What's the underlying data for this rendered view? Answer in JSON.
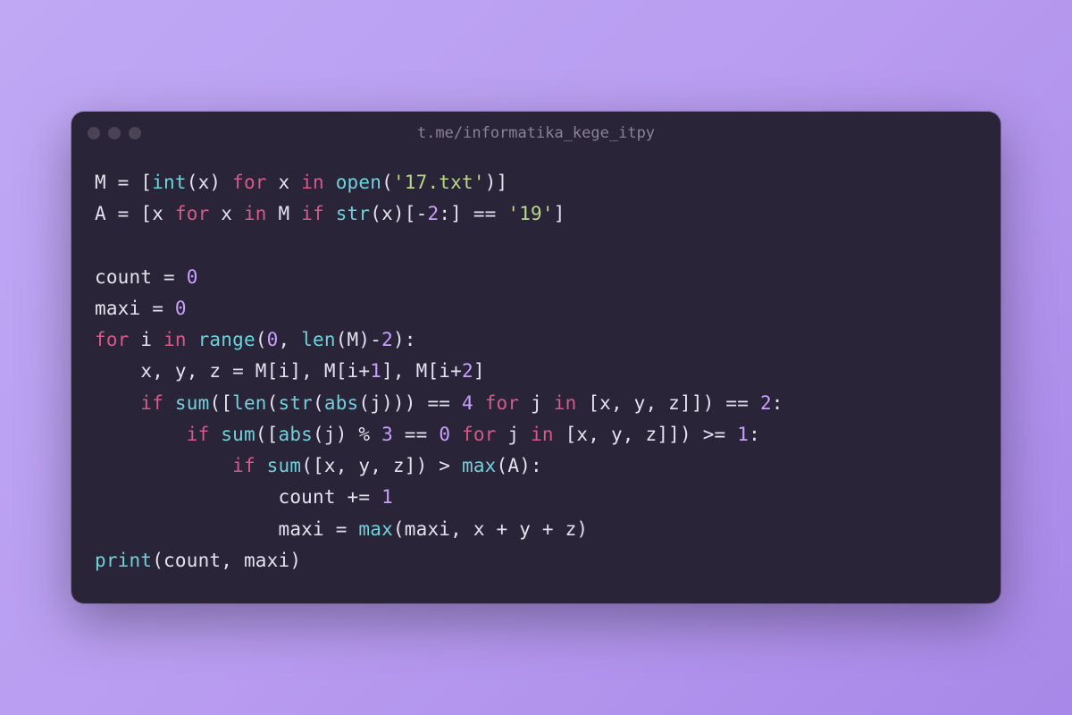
{
  "window": {
    "title": "t.me/informatika_kege_itpy"
  },
  "code": {
    "lines": [
      [
        {
          "t": "M",
          "c": "var"
        },
        {
          "t": " = [",
          "c": "punc"
        },
        {
          "t": "int",
          "c": "fn"
        },
        {
          "t": "(x) ",
          "c": "punc"
        },
        {
          "t": "for",
          "c": "kw"
        },
        {
          "t": " x ",
          "c": "var"
        },
        {
          "t": "in",
          "c": "kw"
        },
        {
          "t": " ",
          "c": "punc"
        },
        {
          "t": "open",
          "c": "fn"
        },
        {
          "t": "(",
          "c": "punc"
        },
        {
          "t": "'17.txt'",
          "c": "str"
        },
        {
          "t": ")]",
          "c": "punc"
        }
      ],
      [
        {
          "t": "A",
          "c": "var"
        },
        {
          "t": " = [x ",
          "c": "punc"
        },
        {
          "t": "for",
          "c": "kw"
        },
        {
          "t": " x ",
          "c": "var"
        },
        {
          "t": "in",
          "c": "kw"
        },
        {
          "t": " M ",
          "c": "var"
        },
        {
          "t": "if",
          "c": "kw"
        },
        {
          "t": " ",
          "c": "punc"
        },
        {
          "t": "str",
          "c": "fn"
        },
        {
          "t": "(x)[-",
          "c": "punc"
        },
        {
          "t": "2",
          "c": "num"
        },
        {
          "t": ":] == ",
          "c": "punc"
        },
        {
          "t": "'19'",
          "c": "str"
        },
        {
          "t": "]",
          "c": "punc"
        }
      ],
      [],
      [
        {
          "t": "count = ",
          "c": "var"
        },
        {
          "t": "0",
          "c": "num"
        }
      ],
      [
        {
          "t": "maxi = ",
          "c": "var"
        },
        {
          "t": "0",
          "c": "num"
        }
      ],
      [
        {
          "t": "for",
          "c": "kw"
        },
        {
          "t": " i ",
          "c": "var"
        },
        {
          "t": "in",
          "c": "kw"
        },
        {
          "t": " ",
          "c": "punc"
        },
        {
          "t": "range",
          "c": "fn"
        },
        {
          "t": "(",
          "c": "punc"
        },
        {
          "t": "0",
          "c": "num"
        },
        {
          "t": ", ",
          "c": "punc"
        },
        {
          "t": "len",
          "c": "fn"
        },
        {
          "t": "(M)-",
          "c": "punc"
        },
        {
          "t": "2",
          "c": "num"
        },
        {
          "t": "):",
          "c": "punc"
        }
      ],
      [
        {
          "t": "    x, y, z = M[i], M[i+",
          "c": "var"
        },
        {
          "t": "1",
          "c": "num"
        },
        {
          "t": "], M[i+",
          "c": "var"
        },
        {
          "t": "2",
          "c": "num"
        },
        {
          "t": "]",
          "c": "var"
        }
      ],
      [
        {
          "t": "    ",
          "c": "var"
        },
        {
          "t": "if",
          "c": "kw"
        },
        {
          "t": " ",
          "c": "punc"
        },
        {
          "t": "sum",
          "c": "fn"
        },
        {
          "t": "([",
          "c": "punc"
        },
        {
          "t": "len",
          "c": "fn"
        },
        {
          "t": "(",
          "c": "punc"
        },
        {
          "t": "str",
          "c": "fn"
        },
        {
          "t": "(",
          "c": "punc"
        },
        {
          "t": "abs",
          "c": "fn"
        },
        {
          "t": "(j))) == ",
          "c": "punc"
        },
        {
          "t": "4",
          "c": "num"
        },
        {
          "t": " ",
          "c": "punc"
        },
        {
          "t": "for",
          "c": "kw"
        },
        {
          "t": " j ",
          "c": "var"
        },
        {
          "t": "in",
          "c": "kw"
        },
        {
          "t": " [x, y, z]]) == ",
          "c": "punc"
        },
        {
          "t": "2",
          "c": "num"
        },
        {
          "t": ":",
          "c": "punc"
        }
      ],
      [
        {
          "t": "        ",
          "c": "var"
        },
        {
          "t": "if",
          "c": "kw"
        },
        {
          "t": " ",
          "c": "punc"
        },
        {
          "t": "sum",
          "c": "fn"
        },
        {
          "t": "([",
          "c": "punc"
        },
        {
          "t": "abs",
          "c": "fn"
        },
        {
          "t": "(j) % ",
          "c": "punc"
        },
        {
          "t": "3",
          "c": "num"
        },
        {
          "t": " == ",
          "c": "punc"
        },
        {
          "t": "0",
          "c": "num"
        },
        {
          "t": " ",
          "c": "punc"
        },
        {
          "t": "for",
          "c": "kw"
        },
        {
          "t": " j ",
          "c": "var"
        },
        {
          "t": "in",
          "c": "kw"
        },
        {
          "t": " [x, y, z]]) >= ",
          "c": "punc"
        },
        {
          "t": "1",
          "c": "num"
        },
        {
          "t": ":",
          "c": "punc"
        }
      ],
      [
        {
          "t": "            ",
          "c": "var"
        },
        {
          "t": "if",
          "c": "kw"
        },
        {
          "t": " ",
          "c": "punc"
        },
        {
          "t": "sum",
          "c": "fn"
        },
        {
          "t": "([x, y, z]) > ",
          "c": "punc"
        },
        {
          "t": "max",
          "c": "fn"
        },
        {
          "t": "(A):",
          "c": "punc"
        }
      ],
      [
        {
          "t": "                count += ",
          "c": "var"
        },
        {
          "t": "1",
          "c": "num"
        }
      ],
      [
        {
          "t": "                maxi = ",
          "c": "var"
        },
        {
          "t": "max",
          "c": "fn"
        },
        {
          "t": "(maxi, x + y + z)",
          "c": "punc"
        }
      ],
      [
        {
          "t": "print",
          "c": "fn"
        },
        {
          "t": "(count, maxi)",
          "c": "punc"
        }
      ]
    ]
  }
}
